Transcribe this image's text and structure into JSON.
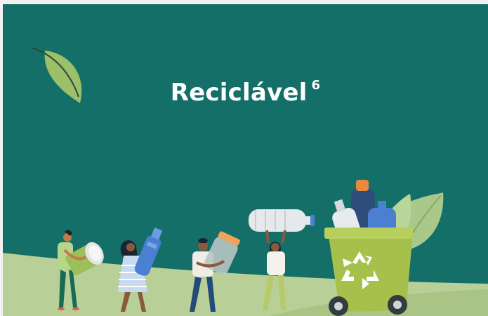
{
  "banner": {
    "title": "Reciclável",
    "footnote": "6"
  },
  "colors": {
    "background": "#136f67",
    "ground": "#b8cf97",
    "leaf": "#9cbf6a",
    "bin": "#a6c04c",
    "bottle_blue": "#4a7fd1"
  },
  "icons": {
    "leaf": "leaf-icon",
    "recycle": "recycle-symbol-icon"
  }
}
